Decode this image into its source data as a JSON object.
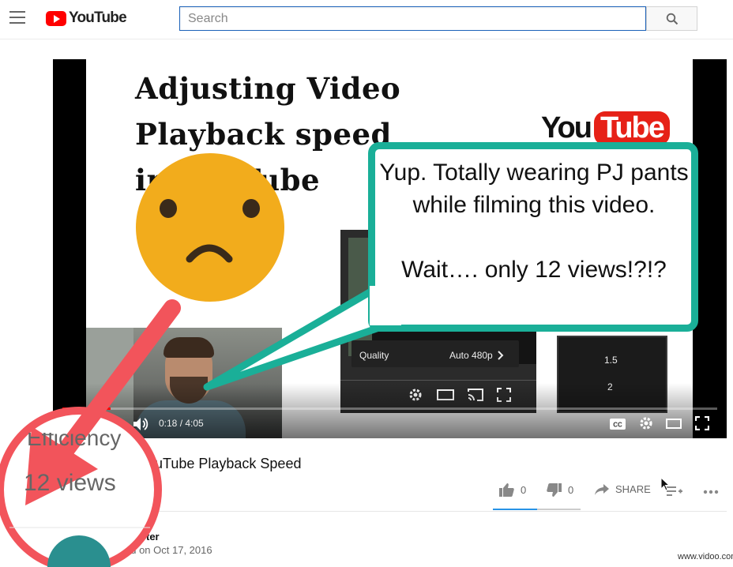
{
  "header": {
    "logo_text": "YouTube",
    "search_placeholder": "Search"
  },
  "video": {
    "slide_title": "Adjusting Video\nPlayback speed\nin YouTube",
    "slide_logo_you": "You",
    "slide_logo_tube": "Tube",
    "settings_quality_label": "Quality",
    "settings_quality_value": "Auto 480p",
    "speed_options": [
      "1.5",
      "2"
    ],
    "time_display": "0:18 / 4:05",
    "progress_fraction": 0.073
  },
  "annotation": {
    "speech_bubble": "Yup.  Totally wearing PJ pants while filming this video.\n\nWait…. only 12 views!?!?",
    "zoom_views": "12 views",
    "zoom_fragment": "Efficiency"
  },
  "below": {
    "title_visible": "ouTube Playback Speed",
    "like_count": "0",
    "dislike_count": "0",
    "share_label": "SHARE",
    "channel_fragment": "ter",
    "published_fragment": "ed on Oct 17, 2016",
    "like_ratio": 0.5
  },
  "watermark": "www.vidoo.com",
  "colors": {
    "brand_red": "#ff0000",
    "bubble_teal": "#1aaf98",
    "annotation_red": "#f2545b",
    "emoji_yellow": "#f2ac1c",
    "like_blue": "#2793e6"
  },
  "icons": [
    "hamburger-icon",
    "search-icon",
    "play-icon",
    "volume-icon",
    "captions-icon",
    "settings-icon",
    "theater-icon",
    "fullscreen-icon",
    "cast-icon",
    "thumbs-up-icon",
    "thumbs-down-icon",
    "share-icon",
    "add-to-playlist-icon",
    "more-icon",
    "chevron-right-icon",
    "cursor-icon"
  ]
}
